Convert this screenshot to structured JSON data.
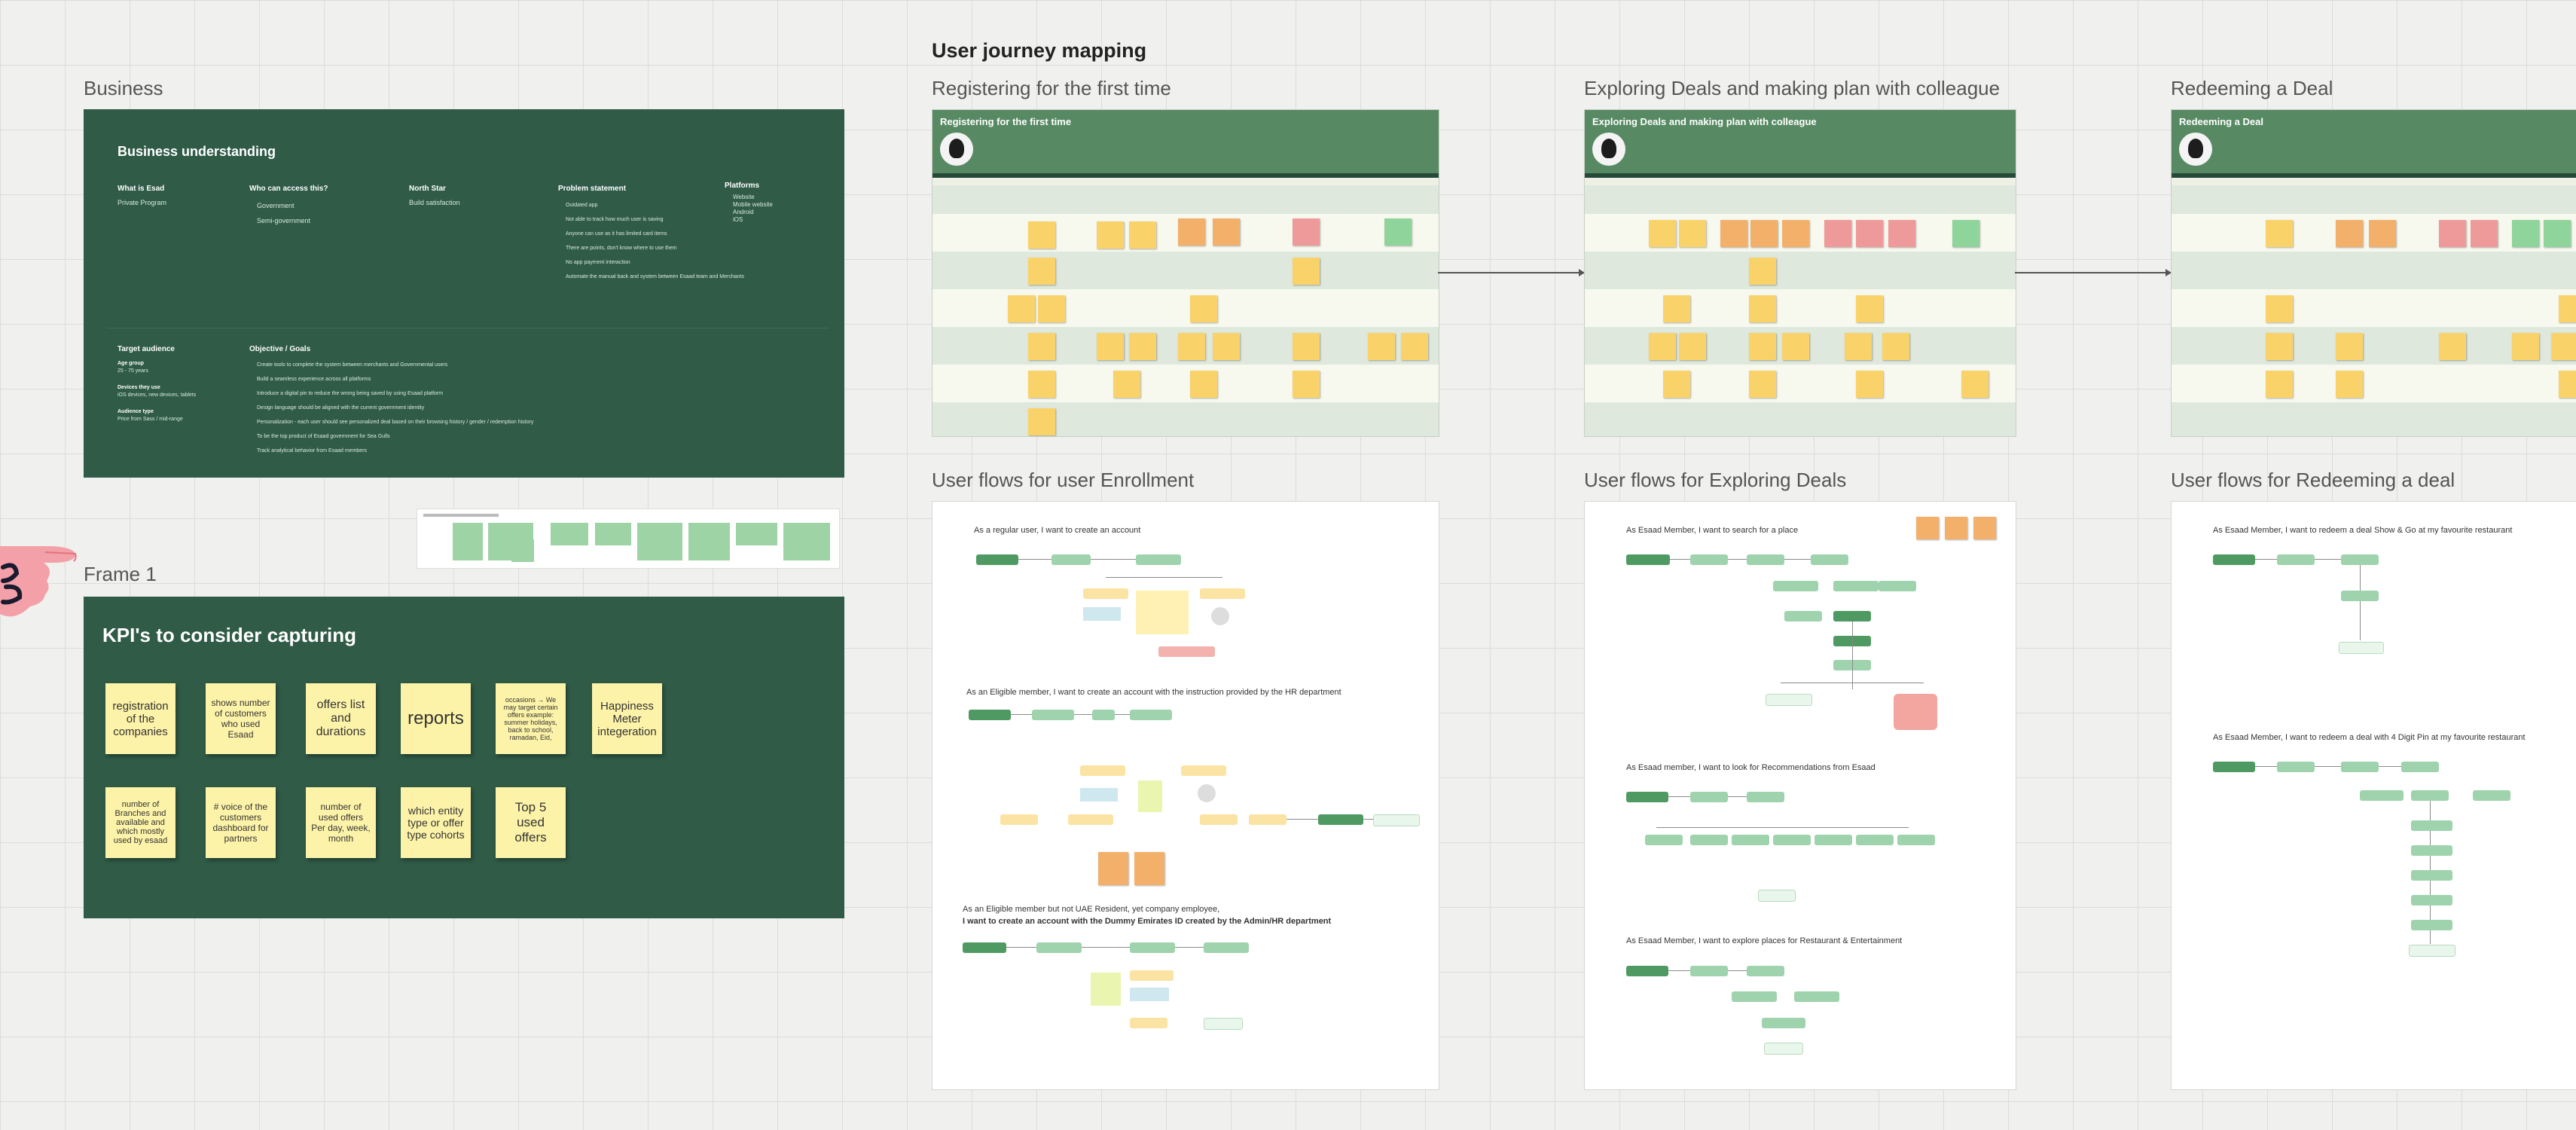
{
  "page_title": "User journey mapping",
  "frame_labels": {
    "business": "Business",
    "frame1": "Frame 1",
    "registering": "Registering for the first time",
    "exploring": "Exploring Deals and making plan with colleague",
    "redeeming": "Redeeming a Deal",
    "flows_enrollment": "User flows for user Enrollment",
    "flows_exploring": "User flows for Exploring Deals",
    "flows_redeeming": "User flows for Redeeming a deal"
  },
  "business": {
    "title": "Business understanding",
    "columns": [
      {
        "heading": "What is Esad",
        "text": "Private Program"
      },
      {
        "heading": "Who can access this?",
        "text": "Government\nSemi-government"
      },
      {
        "heading": "North Star",
        "text": "Build satisfaction"
      },
      {
        "heading": "Problem statement",
        "text": "Outdated app\nNot able to track how much user is saving\nAnyone can use as it has limited card items\nThere are points, don't know where to use them\nNo app payment interaction\nAutomate the manual back and system between Esaad team and Merchants"
      },
      {
        "heading": "Platforms",
        "text": "Website\nMobile website\nAndroid\niOS"
      }
    ],
    "target_heading": "Target audience",
    "target_items": [
      "Age group",
      "25 - 75 years",
      "Devices they use",
      "iOS devices, new devices, tablets",
      "Audience type",
      "Price from Sass / mid-range"
    ],
    "objective_heading": "Objective / Goals",
    "objective_items": [
      "Create tools to complete the system between merchants and Governmental users",
      "Build a seamless experience across all platforms",
      "Introduce a digital pin to reduce the wrong being saved by using Esaad platform",
      "Design language should be aligned with the current government identity",
      "Personalization - each user should see personalized deal based on their browsing history / gender / redemption history",
      "To be the top product of Esaad government for Sea Gulls",
      "Track analytical behavior from Esaad members"
    ]
  },
  "kpi": {
    "title": "KPI's to consider capturing",
    "stickies": [
      "registration of the companies",
      "shows number of customers who used Esaad",
      "offers list and durations",
      "reports",
      "occasions → We may target certain offers example: summer holidays, back to school, ramadan, Eid,",
      "Happiness Meter integeration",
      "number of Branches and available and which mostly used by esaad",
      "# voice of the customers dashboard for partners",
      "number of used offers Per day, week, month",
      "which entity type or offer type cohorts",
      "Top 5 used offers"
    ]
  },
  "journeys": {
    "registering_title": "Registering for the first time",
    "exploring_title": "Exploring Deals and making plan with colleague",
    "redeeming_title": "Redeeming a Deal"
  },
  "flows": {
    "enrollment": [
      "As a regular user, I want to create an account",
      "As an Eligible member, I want to create an account with the instruction provided by the HR department",
      "As an Eligible member but not UAE Resident, yet company employee,",
      "I want to create an account with the Dummy Emirates ID created by the Admin/HR department"
    ],
    "exploring": [
      "As Esaad Member, I want to search for a place",
      "As Esaad member, I want to look for Recommendations from Esaad",
      "As Esaad Member, I want to explore places for Restaurant & Entertainment"
    ],
    "redeeming": [
      "As Esaad Member, I want to redeem a deal Show & Go at my favourite restaurant",
      "As Esaad Member, I want to redeem a deal with 4 Digit Pin at my favourite restaurant"
    ]
  },
  "colors": {
    "dark_green": "#2f5b47",
    "journey_header": "#578a63",
    "sticky_yellow": "#fdf3a8",
    "canvas": "#f0f0ee"
  },
  "icons": [
    "hand-pointer-icon",
    "avatar-icon"
  ]
}
